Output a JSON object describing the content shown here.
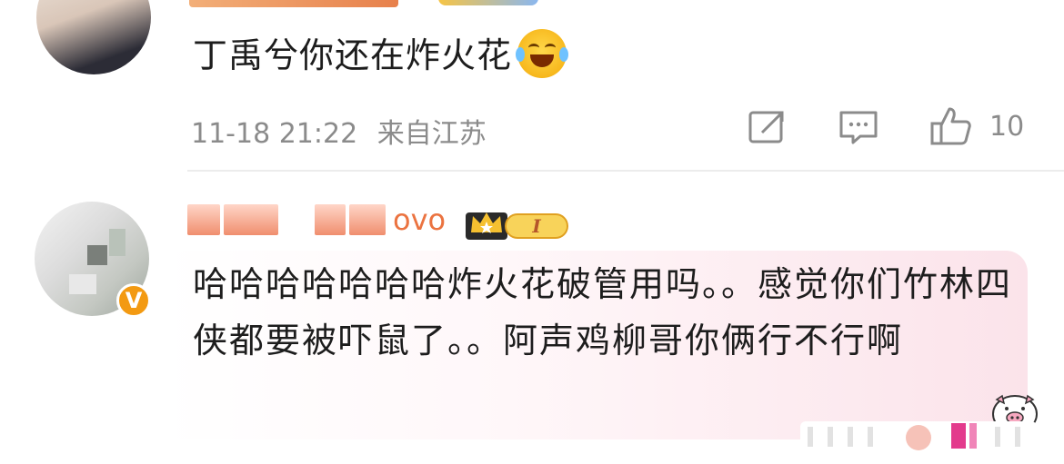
{
  "comments": [
    {
      "text": "丁禹兮你还在炸火花",
      "emoji": "laughing-tears",
      "date": "11-18 21:22",
      "source": "来自江苏",
      "likes": "10"
    },
    {
      "username_visible": "ovo",
      "level_badge": "I",
      "text": "哈哈哈哈哈哈哈炸火花破管用吗。。感觉你们竹林四侠都要被吓鼠了。。阿声鸡柳哥你俩行不行啊",
      "verified_badge": "V"
    }
  ],
  "colors": {
    "username": "#eb7340",
    "meta": "#8b8b8b",
    "verified": "#f39a12",
    "bubble_pink": "#fbe3ea"
  },
  "icons": [
    "share-icon",
    "comment-icon",
    "like-icon"
  ]
}
